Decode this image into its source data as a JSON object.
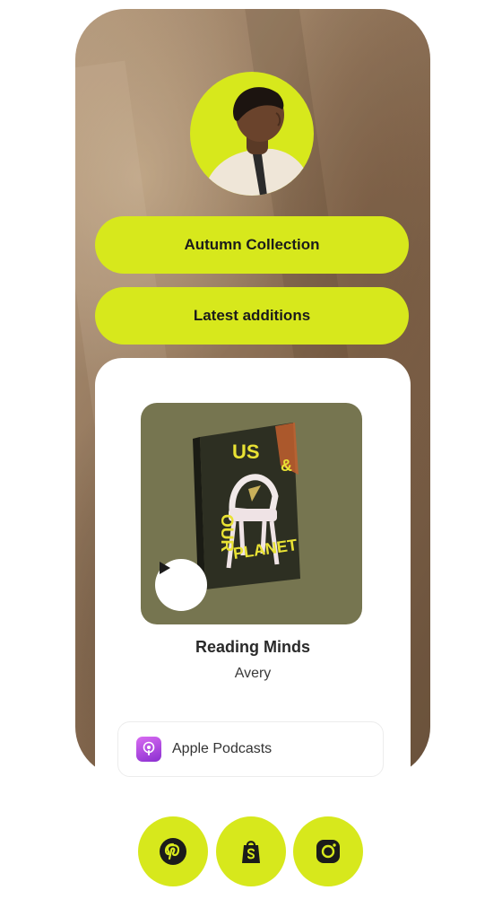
{
  "profile": {
    "avatar_icon": "profile-photo",
    "background_icon": "background-photo"
  },
  "links": [
    {
      "label": "Autumn Collection"
    },
    {
      "label": "Latest additions"
    }
  ],
  "media_card": {
    "cover_text": [
      "US",
      "&",
      "OUR",
      "PLANET"
    ],
    "play_icon": "play-icon",
    "title": "Reading Minds",
    "artist": "Avery",
    "provider": {
      "label": "Apple Podcasts",
      "icon": "apple-podcasts-icon"
    }
  },
  "social": [
    {
      "icon": "pinterest-icon"
    },
    {
      "icon": "shopify-icon"
    },
    {
      "icon": "instagram-icon"
    }
  ],
  "colors": {
    "accent": "#d7e81c",
    "cover_bg": "#767550",
    "card_bg": "#ffffff",
    "text_dark": "#1b1b1b"
  }
}
